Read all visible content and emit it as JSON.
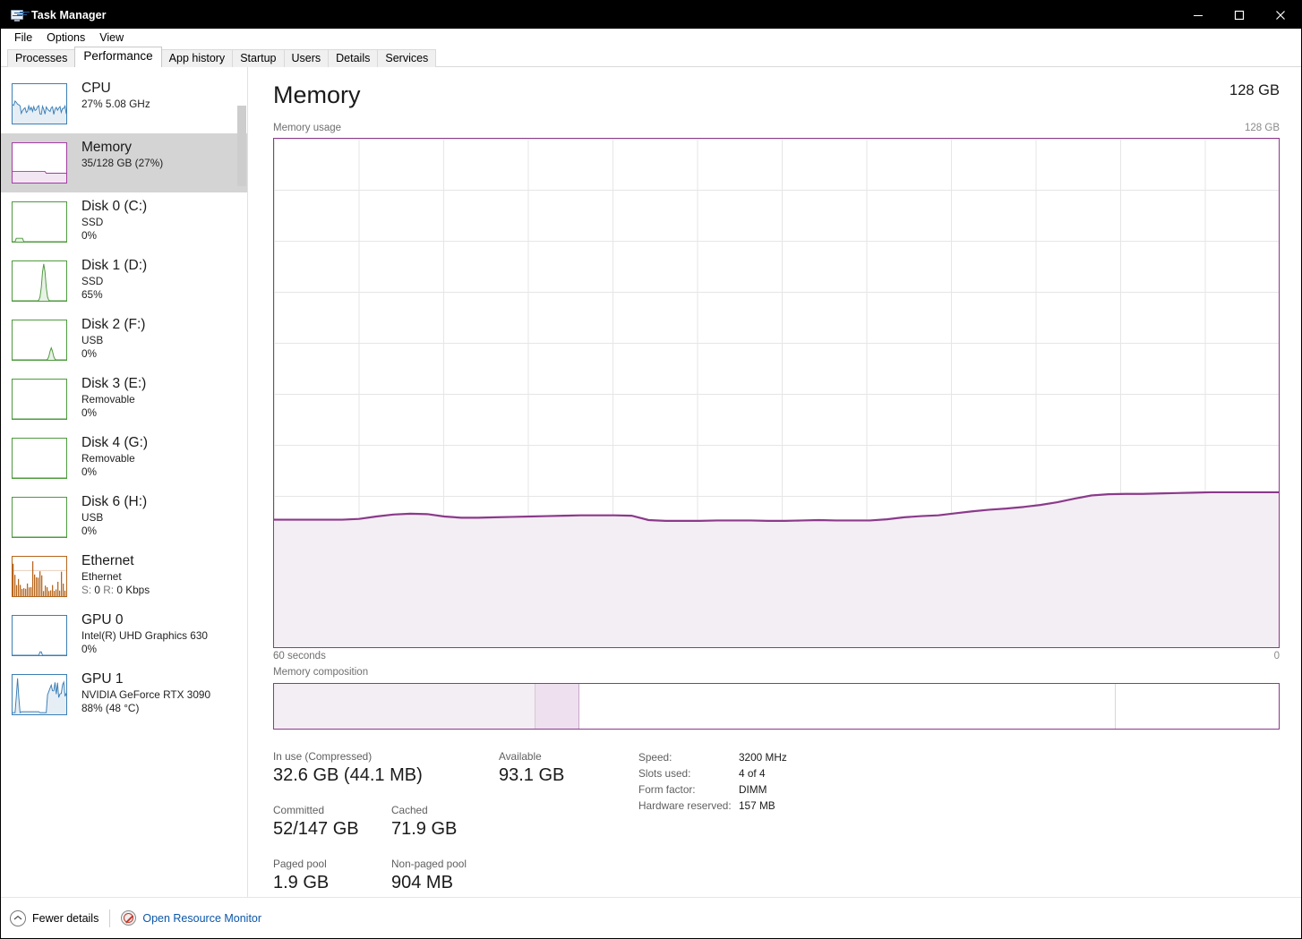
{
  "window": {
    "title": "Task Manager",
    "icon": "task-manager-icon",
    "minimize": "–",
    "maximize": "□",
    "close": "✕"
  },
  "menu": [
    "File",
    "Options",
    "View"
  ],
  "tabs": [
    {
      "label": "Processes",
      "active": false
    },
    {
      "label": "Performance",
      "active": true
    },
    {
      "label": "App history",
      "active": false
    },
    {
      "label": "Startup",
      "active": false
    },
    {
      "label": "Users",
      "active": false
    },
    {
      "label": "Details",
      "active": false
    },
    {
      "label": "Services",
      "active": false
    }
  ],
  "sidebar": {
    "items": [
      {
        "title": "CPU",
        "line1": "27%  5.08 GHz",
        "line2": "",
        "color": "#3b7fb5",
        "selected": false,
        "graph": "cpu"
      },
      {
        "title": "Memory",
        "line1": "35/128 GB (27%)",
        "line2": "",
        "color": "#a23ba2",
        "selected": true,
        "graph": "memory"
      },
      {
        "title": "Disk 0 (C:)",
        "line1": "SSD",
        "line2": "0%",
        "color": "#4e9a3e",
        "selected": false,
        "graph": "disk0"
      },
      {
        "title": "Disk 1 (D:)",
        "line1": "SSD",
        "line2": "65%",
        "color": "#4e9a3e",
        "selected": false,
        "graph": "disk1"
      },
      {
        "title": "Disk 2 (F:)",
        "line1": "USB",
        "line2": "0%",
        "color": "#4e9a3e",
        "selected": false,
        "graph": "disk2"
      },
      {
        "title": "Disk 3 (E:)",
        "line1": "Removable",
        "line2": "0%",
        "color": "#4e9a3e",
        "selected": false,
        "graph": "flat"
      },
      {
        "title": "Disk 4 (G:)",
        "line1": "Removable",
        "line2": "0%",
        "color": "#4e9a3e",
        "selected": false,
        "graph": "flat"
      },
      {
        "title": "Disk 6 (H:)",
        "line1": "USB",
        "line2": "0%",
        "color": "#4e9a3e",
        "selected": false,
        "graph": "flat"
      },
      {
        "title": "Ethernet",
        "line1": "Ethernet",
        "line2": "S: 0 R: 0 Kbps",
        "color": "#b5651d",
        "selected": false,
        "graph": "ethernet"
      },
      {
        "title": "GPU 0",
        "line1": "Intel(R) UHD Graphics 630",
        "line2": "0%",
        "color": "#3b7fb5",
        "selected": false,
        "graph": "gpu0"
      },
      {
        "title": "GPU 1",
        "line1": "NVIDIA GeForce RTX 3090",
        "line2": "88%  (48 °C)",
        "color": "#3b7fb5",
        "selected": false,
        "graph": "gpu1"
      }
    ]
  },
  "main": {
    "title": "Memory",
    "capacity": "128 GB",
    "usage_label": "Memory usage",
    "usage_max": "128 GB",
    "axis_left": "60 seconds",
    "axis_right": "0",
    "composition_label": "Memory composition",
    "accent": "#8b3a8b",
    "fill": "#f3eef3"
  },
  "chart_data": {
    "type": "area",
    "title": "Memory usage",
    "ylabel": "128 GB",
    "xlabel": "60 seconds",
    "ylim": [
      0,
      128
    ],
    "xlim": [
      60,
      0
    ],
    "grid": true,
    "unit": "GB",
    "series": [
      {
        "name": "Memory in use",
        "values": [
          32.1,
          32.1,
          32.1,
          32.1,
          32.1,
          32.3,
          32.9,
          33.4,
          33.6,
          33.5,
          32.9,
          32.6,
          32.6,
          32.7,
          32.8,
          32.9,
          33.0,
          33.1,
          33.2,
          33.2,
          33.2,
          33.1,
          32.0,
          31.8,
          31.8,
          31.8,
          31.9,
          31.9,
          31.9,
          31.8,
          31.8,
          31.9,
          32.0,
          31.9,
          31.9,
          31.9,
          32.2,
          32.7,
          33.0,
          33.2,
          33.7,
          34.2,
          34.6,
          34.9,
          35.3,
          35.8,
          36.5,
          37.4,
          38.2,
          38.5,
          38.6,
          38.6,
          38.7,
          38.8,
          38.9,
          39.0,
          39.0,
          39.0,
          39.0,
          39.0
        ]
      }
    ]
  },
  "composition": {
    "segments": [
      {
        "name": "in-use",
        "pct": 26.0,
        "color": "#f3eef3",
        "border": "#d7c6d7"
      },
      {
        "name": "modified",
        "pct": 4.4,
        "color": "#eee0ee",
        "border": "#c9a8c9"
      },
      {
        "name": "standby",
        "pct": 53.4,
        "color": "#ffffff",
        "border": "#e0d2e0"
      },
      {
        "name": "free",
        "pct": 16.2,
        "color": "#ffffff",
        "border": "#ffffff"
      }
    ]
  },
  "stats": {
    "in_use_label": "In use (Compressed)",
    "in_use_value": "32.6 GB (44.1 MB)",
    "available_label": "Available",
    "available_value": "93.1 GB",
    "committed_label": "Committed",
    "committed_value": "52/147 GB",
    "cached_label": "Cached",
    "cached_value": "71.9 GB",
    "paged_label": "Paged pool",
    "paged_value": "1.9 GB",
    "nonpaged_label": "Non-paged pool",
    "nonpaged_value": "904 MB",
    "details": [
      {
        "key": "Speed:",
        "value": "3200 MHz"
      },
      {
        "key": "Slots used:",
        "value": "4 of 4"
      },
      {
        "key": "Form factor:",
        "value": "DIMM"
      },
      {
        "key": "Hardware reserved:",
        "value": "157 MB"
      }
    ]
  },
  "footer": {
    "fewer_details": "Fewer details",
    "open_resource_monitor": "Open Resource Monitor"
  }
}
